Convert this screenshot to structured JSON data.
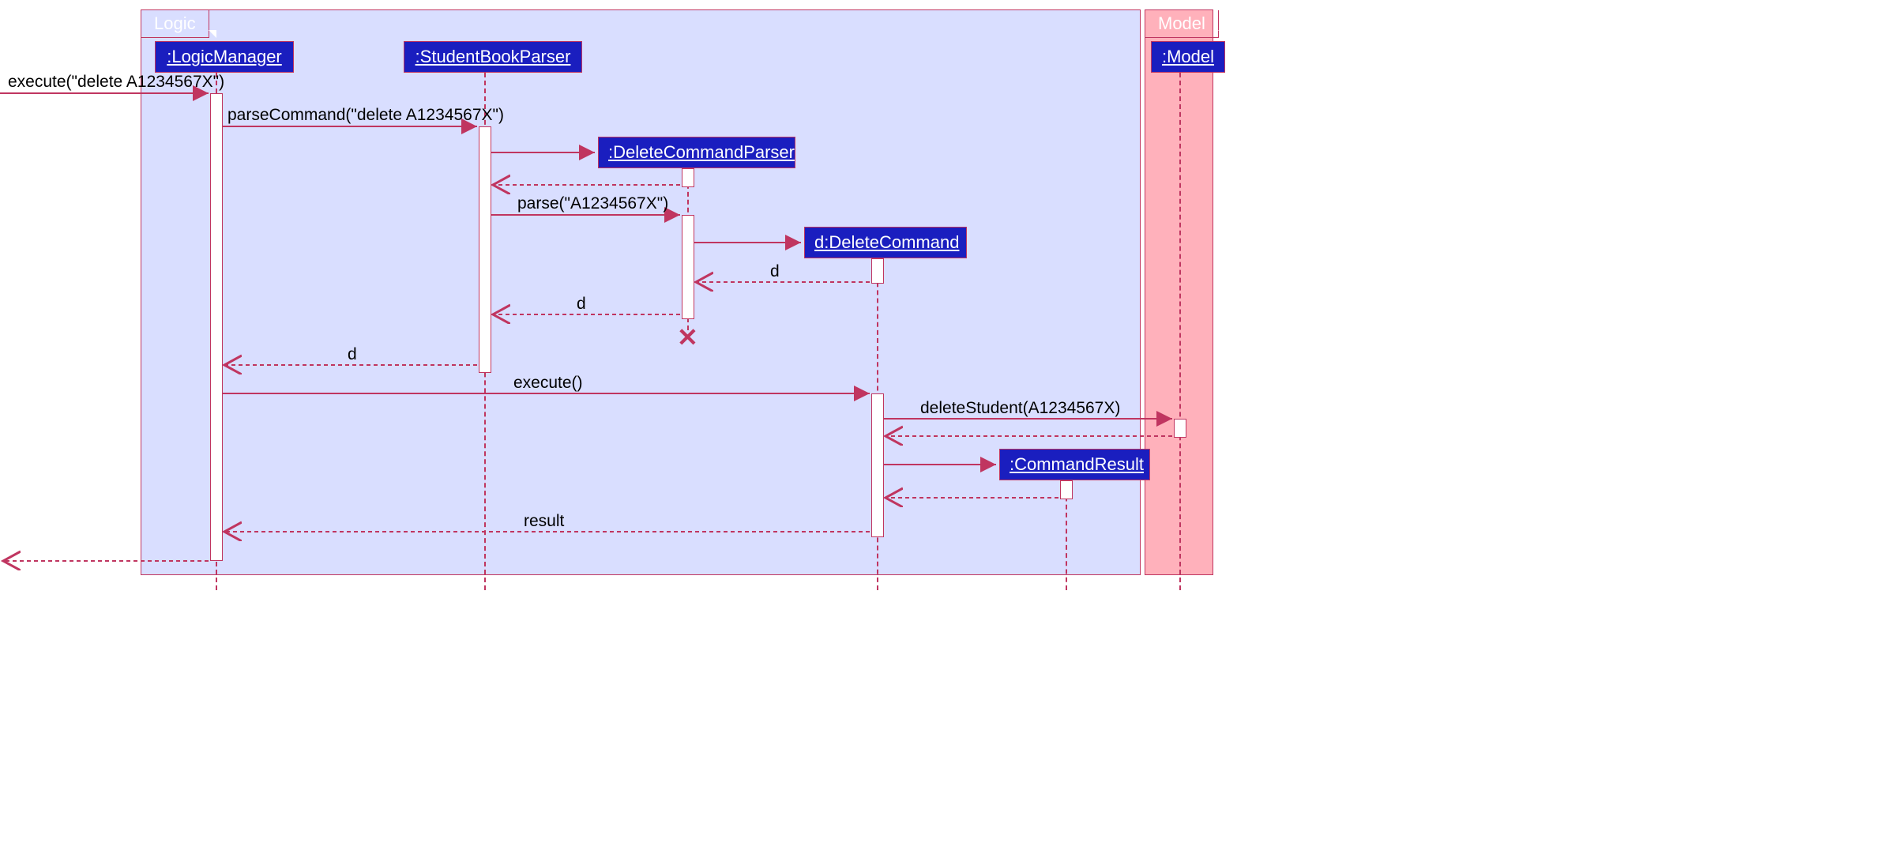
{
  "frames": {
    "logic": "Logic",
    "model": "Model"
  },
  "lifelines": {
    "logicManager": ":LogicManager",
    "studentBookParser": ":StudentBookParser",
    "deleteCommandParser": ":DeleteCommandParser",
    "deleteCommand": "d:DeleteCommand",
    "commandResult": ":CommandResult",
    "model": ":Model"
  },
  "messages": {
    "execute1": "execute(\"delete A1234567X\")",
    "parseCommand": "parseCommand(\"delete A1234567X\")",
    "parse": "parse(\"A1234567X\")",
    "d1": "d",
    "d2": "d",
    "d3": "d",
    "execute2": "execute()",
    "deleteStudent": "deleteStudent(A1234567X)",
    "result": "result"
  }
}
